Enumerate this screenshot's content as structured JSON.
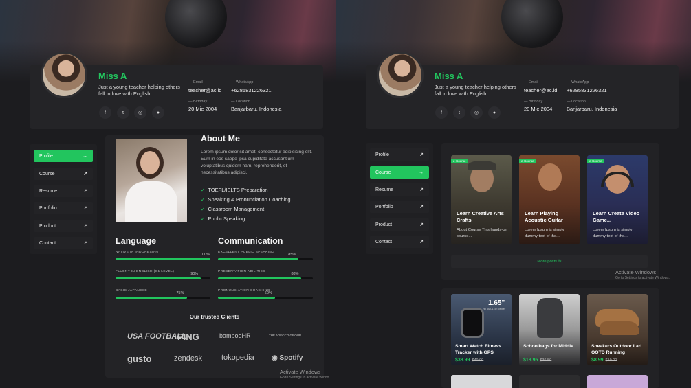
{
  "profile": {
    "name": "Miss A",
    "bio": "Just a young teacher helping others fall in love with English.",
    "email_label": "— Email",
    "email": "teacher@ac.id",
    "whatsapp_label": "— WhatsApp",
    "whatsapp": "+6285831226321",
    "birthday_label": "— Birthday",
    "birthday": "20 Mie 2004",
    "location_label": "— Location",
    "location": "Banjarbaru, Indonesia",
    "social": [
      "facebook-icon",
      "twitter-icon",
      "instagram-icon",
      "github-icon"
    ]
  },
  "menu_left": [
    {
      "label": "Profile",
      "arrow": "→",
      "active": true
    },
    {
      "label": "Course",
      "arrow": "↗"
    },
    {
      "label": "Resume",
      "arrow": "↗"
    },
    {
      "label": "Portfolio",
      "arrow": "↗"
    },
    {
      "label": "Product",
      "arrow": "↗"
    },
    {
      "label": "Contact",
      "arrow": "↗"
    }
  ],
  "menu_right": [
    {
      "label": "Profile",
      "arrow": "↗"
    },
    {
      "label": "Course",
      "arrow": "→",
      "active": true
    },
    {
      "label": "Resume",
      "arrow": "↗"
    },
    {
      "label": "Portfolio",
      "arrow": "↗"
    },
    {
      "label": "Product",
      "arrow": "↗"
    },
    {
      "label": "Contact",
      "arrow": "↗"
    }
  ],
  "about": {
    "title": "About Me",
    "text": "Lorem ipsum dolor sit amet, consectetur adipisicing elit. Eum in eos saepe ipsa cupiditate accusantium voluptatibus quidem nam, reprehenderit, et necessitatibus adipisci.",
    "items": [
      "TOEFL/IELTS Preparation",
      "Speaking & Pronunciation Coaching",
      "Classroom Management",
      "Public Speaking"
    ]
  },
  "language": {
    "title": "Language",
    "skills": [
      {
        "label": "NATIVE IN INDONESIAN",
        "value": 100,
        "text": "100%"
      },
      {
        "label": "FLUENT IN ENGLISH (C1 LEVEL)",
        "value": 90,
        "text": "90%"
      },
      {
        "label": "BASIC JAPANESE",
        "value": 75,
        "text": "75%"
      }
    ]
  },
  "communication": {
    "title": "Communication",
    "skills": [
      {
        "label": "EXCELLENT PUBLIC SPEAKING",
        "value": 85,
        "text": "85%"
      },
      {
        "label": "PRESENTATION ABILITIES",
        "value": 88,
        "text": "88%"
      },
      {
        "label": "PRONUNCIATION COACHING",
        "value": 60,
        "text": "60%"
      }
    ]
  },
  "clients": {
    "title": "Our trusted Clients",
    "logos": [
      "USA FOOTBALL",
      "PING",
      "bambooHR",
      "THE ADECCO GROUP",
      "gusto",
      "zendesk",
      "tokopedia",
      "Spotify"
    ]
  },
  "courses": [
    {
      "badge": "e-Course",
      "title": "Learn Creative Arts Crafts",
      "desc": "About Course This hands-on course..."
    },
    {
      "badge": "e-Course",
      "title": "Learn Playing Acoustic Guitar",
      "desc": "Lorem Ipsum is simply dummy text of the..."
    },
    {
      "badge": "e-Course",
      "title": "Learn Create Video Game...",
      "desc": "Lorem Ipsum is simply dummy text of the..."
    }
  ],
  "more_posts": "More posts",
  "products": [
    {
      "title": "Smart Watch Fitness Tracker with GPS",
      "price": "$38.99",
      "old": "$49.00"
    },
    {
      "title": "Schoolbags for Middle",
      "price": "$18.95",
      "old": "$36.50"
    },
    {
      "title": "Sneakers Outdoor Lari OOTD Running",
      "price": "$8.99",
      "old": "$19.00"
    }
  ],
  "watch_display": {
    "big": "1.65\"",
    "small": "HD AMOLED Display"
  },
  "watermark": {
    "title": "Activate Windows",
    "sub": "Go to Settings to activate Windows."
  },
  "watermark_left": {
    "title": "Activate Windows",
    "sub": "Go to Settings to activate Windo"
  },
  "colors": {
    "accent": "#22c55e",
    "background": "#1c1c1f",
    "card": "#242427"
  }
}
